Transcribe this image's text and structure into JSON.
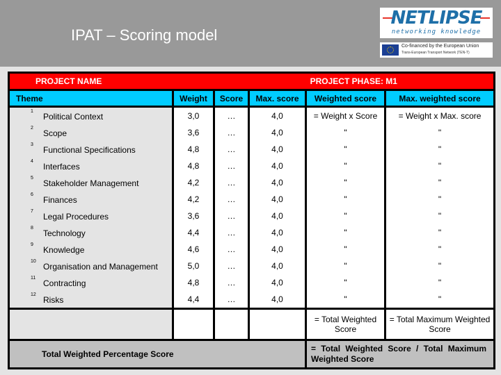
{
  "header": {
    "title": "IPAT – Scoring model",
    "logo": {
      "name": "NETLIPSE",
      "tagline": "networking knowledge"
    },
    "eu_badge": {
      "line1": "Co-financed by the European Union",
      "line2": "Trans-European Transport Network (TEN-T)"
    }
  },
  "table": {
    "project_name_label": "PROJECT NAME",
    "project_phase_label": "PROJECT PHASE: M1",
    "columns": {
      "theme": "Theme",
      "weight": "Weight",
      "score": "Score",
      "max_score": "Max. score",
      "weighted_score": "Weighted score",
      "max_weighted_score": "Max. weighted score"
    },
    "rows": [
      {
        "num": "1",
        "theme": "Political Context",
        "weight": "3,0",
        "score": "…",
        "max_score": "4,0",
        "weighted_score": "= Weight x Score",
        "max_weighted_score": "= Weight x Max. score"
      },
      {
        "num": "2",
        "theme": "Scope",
        "weight": "3,6",
        "score": "…",
        "max_score": "4,0",
        "weighted_score": "\"",
        "max_weighted_score": "\""
      },
      {
        "num": "3",
        "theme": "Functional Specifications",
        "weight": "4,8",
        "score": "…",
        "max_score": "4,0",
        "weighted_score": "\"",
        "max_weighted_score": "\""
      },
      {
        "num": "4",
        "theme": "Interfaces",
        "weight": "4,8",
        "score": "…",
        "max_score": "4,0",
        "weighted_score": "\"",
        "max_weighted_score": "\""
      },
      {
        "num": "5",
        "theme": "Stakeholder Management",
        "weight": "4,2",
        "score": "…",
        "max_score": "4,0",
        "weighted_score": "\"",
        "max_weighted_score": "\""
      },
      {
        "num": "6",
        "theme": "Finances",
        "weight": "4,2",
        "score": "…",
        "max_score": "4,0",
        "weighted_score": "\"",
        "max_weighted_score": "\""
      },
      {
        "num": "7",
        "theme": "Legal Procedures",
        "weight": "3,6",
        "score": "…",
        "max_score": "4,0",
        "weighted_score": "\"",
        "max_weighted_score": "\""
      },
      {
        "num": "8",
        "theme": "Technology",
        "weight": "4,4",
        "score": "…",
        "max_score": "4,0",
        "weighted_score": "\"",
        "max_weighted_score": "\""
      },
      {
        "num": "9",
        "theme": "Knowledge",
        "weight": "4,6",
        "score": "…",
        "max_score": "4,0",
        "weighted_score": "\"",
        "max_weighted_score": "\""
      },
      {
        "num": "10",
        "theme": "Organisation and Management",
        "weight": "5,0",
        "score": "…",
        "max_score": "4,0",
        "weighted_score": "\"",
        "max_weighted_score": "\""
      },
      {
        "num": "11",
        "theme": "Contracting",
        "weight": "4,8",
        "score": "…",
        "max_score": "4,0",
        "weighted_score": "\"",
        "max_weighted_score": "\""
      },
      {
        "num": "12",
        "theme": "Risks",
        "weight": "4,4",
        "score": "…",
        "max_score": "4,0",
        "weighted_score": "\"",
        "max_weighted_score": "\""
      }
    ],
    "totals": {
      "weighted_score": "= Total Weighted Score",
      "max_weighted_score": "= Total Maximum Weighted Score"
    },
    "footer": {
      "label": "Total Weighted Percentage Score",
      "formula": "= Total Weighted Score / Total Maximum Weighted Score"
    }
  }
}
